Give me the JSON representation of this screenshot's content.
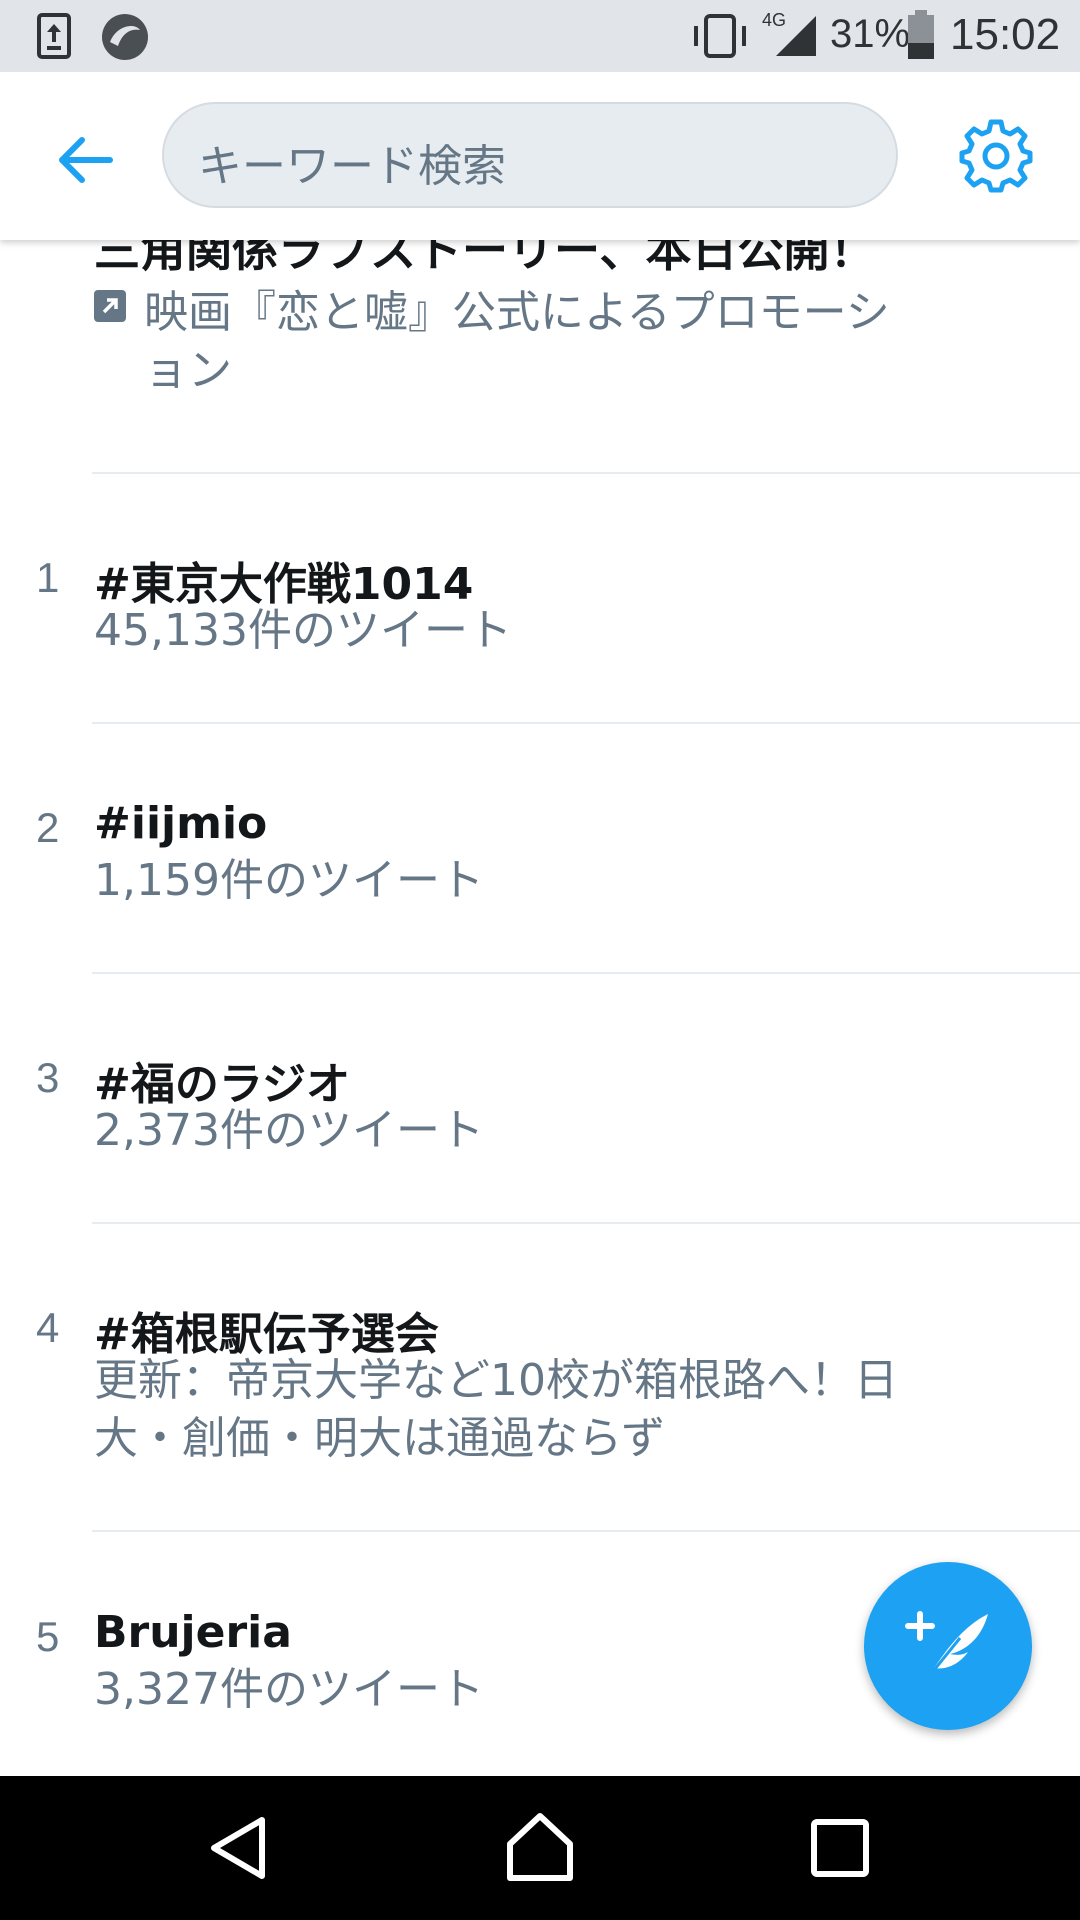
{
  "status_bar": {
    "battery": "31%",
    "time": "15:02",
    "network": "4G",
    "icons": [
      "upload-icon",
      "app-circle-icon",
      "vibrate-icon",
      "signal-icon",
      "battery-icon"
    ]
  },
  "header": {
    "back_icon": "arrow-left-icon",
    "search_placeholder": "キーワード検索",
    "settings_icon": "gear-icon",
    "accent_color": "#1da1f2"
  },
  "promoted": {
    "title_cut": "三角関係ラブストーリー、本日公開！",
    "label": "映画『恋と嘘』公式によるプロモーション"
  },
  "trends": [
    {
      "rank": "1",
      "title": "#東京大作戦1014",
      "meta": "45,133件のツイート"
    },
    {
      "rank": "2",
      "title": "#iijmio",
      "meta": "1,159件のツイート"
    },
    {
      "rank": "3",
      "title": "#福のラジオ",
      "meta": "2,373件のツイート"
    },
    {
      "rank": "4",
      "title": "#箱根駅伝予選会",
      "meta": "更新：帝京大学など10校が箱根路へ！日大・創価・明大は通過ならず"
    },
    {
      "rank": "5",
      "title": "Brujeria",
      "meta": "3,327件のツイート"
    }
  ],
  "fab": {
    "icon": "compose-tweet-icon"
  },
  "nav": {
    "icons": [
      "back-triangle-icon",
      "home-icon",
      "recents-icon"
    ]
  }
}
